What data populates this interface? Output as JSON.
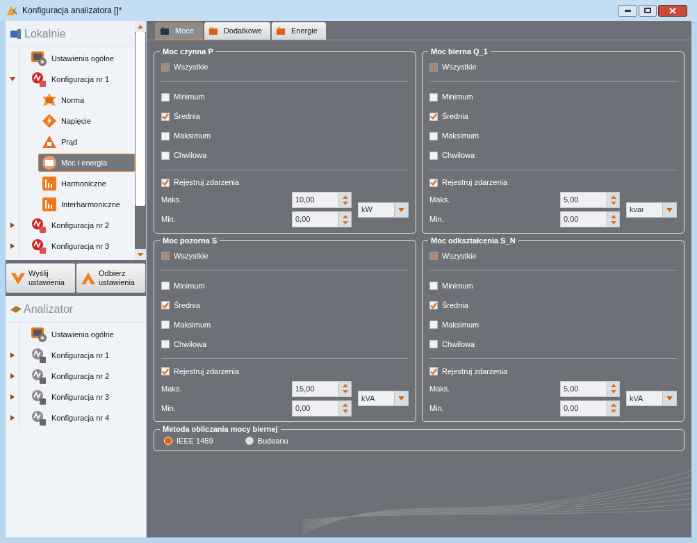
{
  "window": {
    "title": "Konfiguracja analizatora []*"
  },
  "local": {
    "header": "Lokalnie",
    "items": [
      {
        "label": "Ustawienia ogólne",
        "kind": "settings",
        "selected": false
      },
      {
        "label": "Konfiguracja nr 1",
        "kind": "config",
        "selected": false,
        "expanded": true,
        "children": [
          {
            "label": "Norma",
            "kind": "norm",
            "selected": false
          },
          {
            "label": "Napięcie",
            "kind": "voltage",
            "selected": false
          },
          {
            "label": "Prąd",
            "kind": "current",
            "selected": false
          },
          {
            "label": "Moc i energia",
            "kind": "power",
            "selected": true
          },
          {
            "label": "Harmoniczne",
            "kind": "harmonics",
            "selected": false
          },
          {
            "label": "Interharmoniczne",
            "kind": "harmonics",
            "selected": false
          }
        ]
      },
      {
        "label": "Konfiguracja nr 2",
        "kind": "config",
        "selected": false,
        "expanded": false
      },
      {
        "label": "Konfiguracja nr 3",
        "kind": "config",
        "selected": false,
        "expanded": false
      }
    ]
  },
  "actions": [
    {
      "label": "Wyślij ustawienia",
      "kind": "send"
    },
    {
      "label": "Odbierz ustawienia",
      "kind": "receive"
    }
  ],
  "analyzer": {
    "header": "Analizator",
    "items": [
      {
        "label": "Ustawienia ogólne",
        "kind": "settings",
        "selected": false
      },
      {
        "label": "Konfiguracja nr 1",
        "kind": "config",
        "selected": false,
        "expanded": false
      },
      {
        "label": "Konfiguracja nr 2",
        "kind": "config",
        "selected": false,
        "expanded": false
      },
      {
        "label": "Konfiguracja nr 3",
        "kind": "config",
        "selected": false,
        "expanded": false
      },
      {
        "label": "Konfiguracja nr 4",
        "kind": "config",
        "selected": false,
        "expanded": false
      }
    ]
  },
  "tabs": [
    {
      "label": "Moce",
      "selected": true
    },
    {
      "label": "Dodatkowe",
      "selected": false
    },
    {
      "label": "Energie",
      "selected": false
    }
  ],
  "groups": [
    {
      "title": "Moc czynna P",
      "all": {
        "label": "Wszystkie",
        "indeterminate": true
      },
      "options": [
        {
          "label": "Minimum",
          "checked": false
        },
        {
          "label": "Średnia",
          "checked": true
        },
        {
          "label": "Maksimum",
          "checked": false
        },
        {
          "label": "Chwilowa",
          "checked": false
        }
      ],
      "events": {
        "label": "Rejestruj zdarzenia",
        "checked": true
      },
      "max": {
        "label": "Maks.",
        "value": "10,00"
      },
      "min": {
        "label": "Min.",
        "value": "0,00"
      },
      "unit": "kW"
    },
    {
      "title": "Moc bierna Q_1",
      "all": {
        "label": "Wszystkie",
        "indeterminate": true
      },
      "options": [
        {
          "label": "Minimum",
          "checked": false
        },
        {
          "label": "Średnia",
          "checked": true
        },
        {
          "label": "Maksimum",
          "checked": false
        },
        {
          "label": "Chwilowa",
          "checked": false
        }
      ],
      "events": {
        "label": "Rejestruj zdarzenia",
        "checked": true
      },
      "max": {
        "label": "Maks.",
        "value": "5,00"
      },
      "min": {
        "label": "Min.",
        "value": "0,00"
      },
      "unit": "kvar"
    },
    {
      "title": "Moc pozorna S",
      "all": {
        "label": "Wszystkie",
        "indeterminate": true
      },
      "options": [
        {
          "label": "Minimum",
          "checked": false
        },
        {
          "label": "Średnia",
          "checked": true
        },
        {
          "label": "Maksimum",
          "checked": false
        },
        {
          "label": "Chwilowa",
          "checked": false
        }
      ],
      "events": {
        "label": "Rejestruj zdarzenia",
        "checked": true
      },
      "max": {
        "label": "Maks.",
        "value": "15,00"
      },
      "min": {
        "label": "Min.",
        "value": "0,00"
      },
      "unit": "kVA"
    },
    {
      "title": "Moc odkształcenia S_N",
      "all": {
        "label": "Wszystkie",
        "indeterminate": true
      },
      "options": [
        {
          "label": "Minimum",
          "checked": false
        },
        {
          "label": "Średnia",
          "checked": true
        },
        {
          "label": "Maksimum",
          "checked": false
        },
        {
          "label": "Chwilowa",
          "checked": false
        }
      ],
      "events": {
        "label": "Rejestruj zdarzenia",
        "checked": true
      },
      "max": {
        "label": "Maks.",
        "value": "5,00"
      },
      "min": {
        "label": "Min.",
        "value": "0,00"
      },
      "unit": "kVA"
    }
  ],
  "method": {
    "title": "Metoda obliczania mocy biernej",
    "options": [
      {
        "label": "IEEE 1459",
        "selected": true
      },
      {
        "label": "Budeanu",
        "selected": false
      }
    ]
  }
}
